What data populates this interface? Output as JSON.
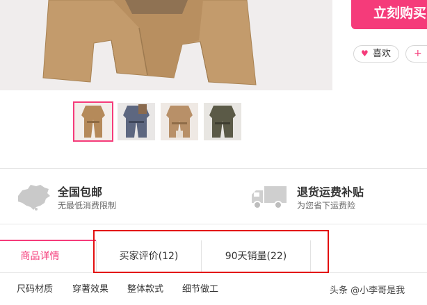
{
  "purchase": {
    "buy_now_label": "立刻购买",
    "like_label": "喜欢",
    "add_label": "+"
  },
  "thumbnails": [
    {
      "name": "thumbnail-1",
      "color": "#b58a5a",
      "selected": true
    },
    {
      "name": "thumbnail-2",
      "color": "#5d6780",
      "selected": false
    },
    {
      "name": "thumbnail-3",
      "color": "#b89068",
      "selected": false
    },
    {
      "name": "thumbnail-4",
      "color": "#5b5a47",
      "selected": false
    }
  ],
  "services": [
    {
      "icon": "china-map-icon",
      "title": "全国包邮",
      "subtitle": "无最低消费限制"
    },
    {
      "icon": "delivery-truck-icon",
      "title": "退货运费补贴",
      "subtitle": "为您省下运费险"
    }
  ],
  "tabs": [
    {
      "label": "商品详情",
      "active": true
    },
    {
      "label": "买家评价(12)",
      "active": false
    },
    {
      "label": "90天销量(22)",
      "active": false
    }
  ],
  "subtabs": [
    "尺码材质",
    "穿著效果",
    "整体款式",
    "细节做工"
  ],
  "watermark": "头条 @小李哥是我",
  "colors": {
    "accent": "#f53b7a",
    "highlight_box": "#e30e0e",
    "coat": "#c39b6c"
  }
}
